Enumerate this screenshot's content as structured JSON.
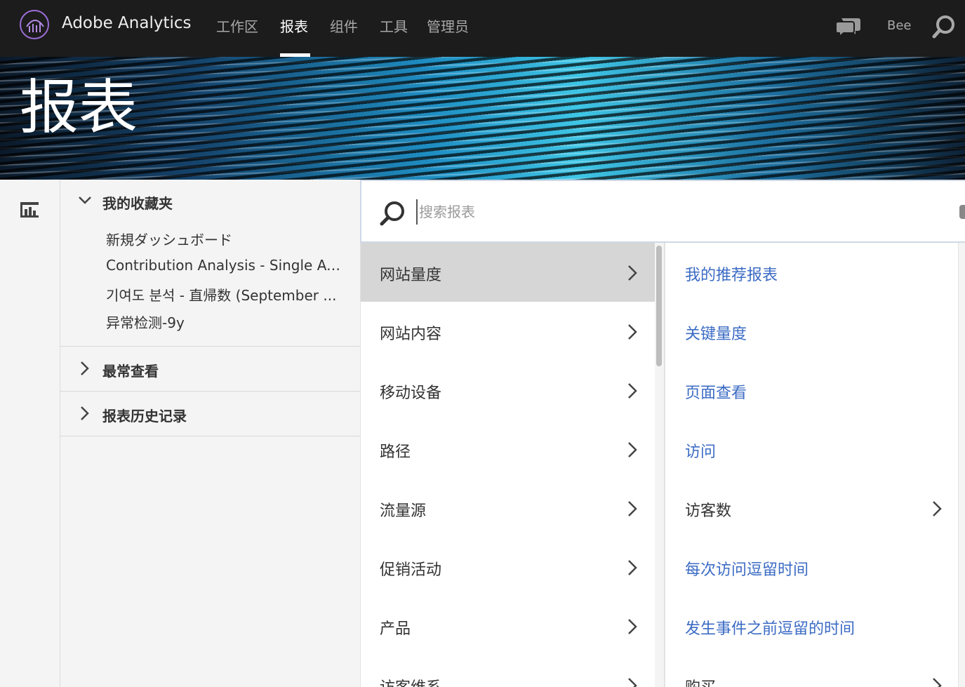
{
  "app": {
    "brand": "Adobe Analytics",
    "user": "Bee"
  },
  "nav": {
    "items": [
      {
        "label": "工作区"
      },
      {
        "label": "报表",
        "active": true
      },
      {
        "label": "组件"
      },
      {
        "label": "工具"
      },
      {
        "label": "管理员"
      }
    ]
  },
  "banner": {
    "title": "报表"
  },
  "sidebar": {
    "favorites": {
      "title": "我的收藏夹",
      "expanded": true,
      "items": [
        "新規ダッシュボード",
        "Contribution Analysis - Single Ac...",
        "기여도 분석 - 直帰数 (September ...",
        "异常检测-9y"
      ]
    },
    "most_viewed": {
      "title": "最常查看",
      "expanded": false
    },
    "history": {
      "title": "报表历史记录",
      "expanded": false
    }
  },
  "search": {
    "placeholder": "搜索报表",
    "value": ""
  },
  "categories": [
    {
      "label": "网站量度",
      "selected": true
    },
    {
      "label": "网站内容"
    },
    {
      "label": "移动设备"
    },
    {
      "label": "路径"
    },
    {
      "label": "流量源"
    },
    {
      "label": "促销活动"
    },
    {
      "label": "产品"
    },
    {
      "label": "访客维系"
    }
  ],
  "reports": [
    {
      "label": "我的推荐报表",
      "has_children": false
    },
    {
      "label": "关键量度",
      "has_children": false
    },
    {
      "label": "页面查看",
      "has_children": false
    },
    {
      "label": "访问",
      "has_children": false
    },
    {
      "label": "访客数",
      "has_children": true
    },
    {
      "label": "每次访问逗留时间",
      "has_children": false
    },
    {
      "label": "发生事件之前逗留的时间",
      "has_children": false
    },
    {
      "label": "购买",
      "has_children": true
    }
  ],
  "colors": {
    "topbar": "#1c1c1c",
    "link": "#3b6bc4",
    "selected_row": "#d6d6d6",
    "logo_ring": "#9b6dd6"
  }
}
